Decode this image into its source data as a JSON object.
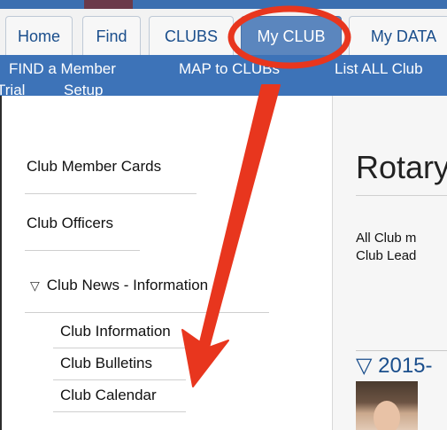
{
  "tabs": [
    {
      "label": "Home",
      "active": false
    },
    {
      "label": "Find",
      "active": false
    },
    {
      "label": "CLUBS",
      "active": false
    },
    {
      "label": "My CLUB",
      "active": true
    },
    {
      "label": "My DATA",
      "active": false
    }
  ],
  "subnav": {
    "row1": [
      "FIND a Member",
      "MAP to CLUBs",
      "List ALL Club"
    ],
    "row2": [
      "Trial",
      "Setup"
    ]
  },
  "sidebar": {
    "items": [
      {
        "label": "Club Member Cards"
      },
      {
        "label": "Club Officers"
      },
      {
        "label": "Club News - Information",
        "expanded": true
      }
    ],
    "subitems": [
      {
        "label": "Club Information"
      },
      {
        "label": "Club Bulletins"
      },
      {
        "label": "Club Calendar"
      }
    ],
    "expand_glyph": "▽"
  },
  "content": {
    "title": "Rotary",
    "text_lines": [
      "All Club m",
      "Club Lead"
    ],
    "year_heading": "▽ 2015-"
  },
  "colors": {
    "accent": "#3d73b8",
    "active_tab": "#5b86be",
    "annotation": "#e8361e"
  }
}
